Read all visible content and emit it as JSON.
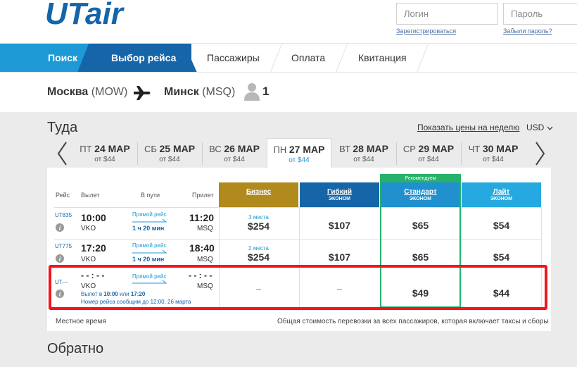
{
  "brand": {
    "logo_text": "UTair",
    "logo_color": "#1565a8"
  },
  "auth": {
    "login_placeholder": "Логин",
    "password_placeholder": "Пароль",
    "register_label": "Зарегистрироваться",
    "forgot_label": "Забыли пароль?"
  },
  "steps": [
    "Поиск",
    "Выбор рейса",
    "Пассажиры",
    "Оплата",
    "Квитанция"
  ],
  "route": {
    "from_city": "Москва",
    "from_code": "(MOW)",
    "to_city": "Минск",
    "to_code": "(MSQ)",
    "passengers": "1"
  },
  "outbound": {
    "title": "Туда",
    "week_link": "Показать цены на неделю",
    "currency": "USD",
    "dates": [
      {
        "dow": "ПТ",
        "day": "24 МАР",
        "price": "от $44"
      },
      {
        "dow": "СБ",
        "day": "25 МАР",
        "price": "от $44"
      },
      {
        "dow": "ВС",
        "day": "26 МАР",
        "price": "от $44"
      },
      {
        "dow": "ПН",
        "day": "27 МАР",
        "price": "от $44"
      },
      {
        "dow": "ВТ",
        "day": "28 МАР",
        "price": "от $44"
      },
      {
        "dow": "СР",
        "day": "29 МАР",
        "price": "от $44"
      },
      {
        "dow": "ЧТ",
        "day": "30 МАР",
        "price": "от $44"
      }
    ],
    "selected_date_index": 3
  },
  "table": {
    "headers": {
      "flight": "Рейс",
      "depart": "Вылет",
      "duration": "В пути",
      "arrive": "Прилет"
    },
    "recommended_badge": "Рекомендуем",
    "fares": [
      {
        "name": "Бизнес",
        "sub": "",
        "color": "#b08a1c"
      },
      {
        "name": "Гибкий",
        "sub": "ЭКОНОМ",
        "color": "#1565a8"
      },
      {
        "name": "Стандарт",
        "sub": "ЭКОНОМ",
        "color": "#2190cf"
      },
      {
        "name": "Лайт",
        "sub": "ЭКОНОМ",
        "color": "#25a9e0"
      }
    ],
    "rows": [
      {
        "flight": "UT835",
        "dep_time": "10:00",
        "dep_airport": "VKO",
        "direct": "Прямой рейс",
        "duration": "1 ч 20 мин",
        "arr_time": "11:20",
        "arr_airport": "MSQ",
        "business_seats": "3 места",
        "business": "$254",
        "flex": "$107",
        "standard": "$65",
        "light": "$54"
      },
      {
        "flight": "UT775",
        "dep_time": "17:20",
        "dep_airport": "VKO",
        "direct": "Прямой рейс",
        "duration": "1 ч 20 мин",
        "arr_time": "18:40",
        "arr_airport": "MSQ",
        "business_seats": "2 места",
        "business": "$254",
        "flex": "$107",
        "standard": "$65",
        "light": "$54"
      },
      {
        "flight": "UT---",
        "dep_time": "- - : - -",
        "dep_airport": "VKO",
        "direct": "Прямой рейс",
        "duration": "",
        "arr_time": "- - : - -",
        "arr_airport": "MSQ",
        "business": "–",
        "flex": "–",
        "standard": "$49",
        "light": "$44",
        "note_prefix": "Вылет в ",
        "note_time1": "10:00",
        "note_or": " или ",
        "note_time2": "17:20",
        "note2": "Номер рейса сообщим до 12:00, 26 марта"
      }
    ],
    "footer_left": "Местное время",
    "footer_right": "Общая стоимость перевозки за всех пассажиров, которая включает таксы и сборы"
  },
  "return": {
    "title": "Обратно"
  }
}
